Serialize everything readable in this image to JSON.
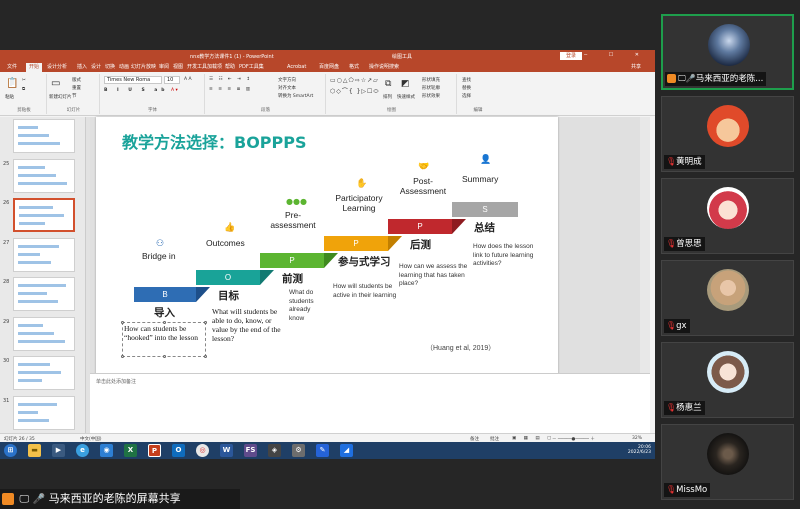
{
  "ppt": {
    "title": "nnx教学方法课件1 (1) - PowerPoint",
    "context_tab": "绘图工具",
    "login": "登录",
    "share": "共享",
    "tabs": [
      "文件",
      "开始",
      "设计分析",
      "插入",
      "设计",
      "切换",
      "动画",
      "幻灯片放映",
      "审阅",
      "视图",
      "开发工具",
      "加载项",
      "帮助",
      "PDF工具集",
      "Acrobat",
      "百度网盘",
      "格式",
      "操作说明搜索"
    ],
    "font_name": "Times New Roma",
    "font_size": "10",
    "ribbon_groups": [
      "剪贴板",
      "幻灯片",
      "字体",
      "段落",
      "绘图",
      "编辑"
    ],
    "ribbon_buttons": {
      "paste": "粘贴",
      "new_slide": "新建幻灯片",
      "layout": "版式",
      "reset": "重置",
      "section": "节",
      "text_direction": "文字方向",
      "align_text": "对齐文本",
      "smartart": "转换为 SmartArt",
      "arrange": "排列",
      "quick_styles": "快速样式",
      "shape_fill": "形状填充",
      "shape_outline": "形状轮廓",
      "shape_effects": "形状效果",
      "find": "查找",
      "replace": "替换",
      "select": "选择"
    },
    "notes_placeholder": "单击此处添加备注",
    "status": {
      "slide_count": "幻灯片 26 / 35",
      "language": "中文(中国)",
      "notes": "备注",
      "comments": "批注",
      "zoom": "32%"
    }
  },
  "thumbnails": [
    {
      "num": "",
      "selected": false
    },
    {
      "num": "25",
      "selected": false
    },
    {
      "num": "26",
      "selected": true
    },
    {
      "num": "27",
      "selected": false
    },
    {
      "num": "28",
      "selected": false
    },
    {
      "num": "29",
      "selected": false
    },
    {
      "num": "30",
      "selected": false
    },
    {
      "num": "31",
      "selected": false
    }
  ],
  "slide": {
    "title": "教学方法选择：BOPPPS",
    "steps": [
      {
        "letter": "B",
        "en": "Bridge in",
        "cn": "导入",
        "color": "#2e6db4",
        "desc": "How can students be “hooked” into the lesson"
      },
      {
        "letter": "O",
        "en": "Outcomes",
        "cn": "目标",
        "color": "#19a398",
        "desc": "What will students be able to do, know, or value by the end of the lesson?"
      },
      {
        "letter": "P",
        "en": "Pre-assessment",
        "cn": "前测",
        "color": "#5cb531",
        "desc": "What do students already know"
      },
      {
        "letter": "P",
        "en": "Participatory Learning",
        "cn": "参与式学习",
        "color": "#f0a30a",
        "desc": "How will students be active in their learning"
      },
      {
        "letter": "P",
        "en": "Post-Assessment",
        "cn": "后测",
        "color": "#c0282d",
        "desc": "How can we assess the learning that has taken place?"
      },
      {
        "letter": "S",
        "en": "Summary",
        "cn": "总结",
        "color": "#a6a6a6",
        "desc": "How does the lesson link to future learning activities?"
      }
    ],
    "citation": "（Huang et al, 2019）"
  },
  "taskbar": {
    "time": "20:06",
    "date": "2022/6/23"
  },
  "participants": [
    {
      "name": "马来西亚的老陈...",
      "active": true,
      "avatar": "city-night"
    },
    {
      "name": "黄明成",
      "active": false,
      "avatar": "graduate"
    },
    {
      "name": "曾思思",
      "active": false,
      "avatar": "girl-cartoon"
    },
    {
      "name": "gx",
      "active": false,
      "avatar": "woman-photo"
    },
    {
      "name": "杨惠兰",
      "active": false,
      "avatar": "anime-girl"
    },
    {
      "name": "MissMo",
      "active": false,
      "avatar": "dark-photo"
    }
  ],
  "share_status": "马来西亚的老陈的屏幕共享",
  "colors": {
    "ppt_accent": "#b7472a",
    "active_border": "#1e9e4c",
    "title_teal": "#1aa39a"
  }
}
